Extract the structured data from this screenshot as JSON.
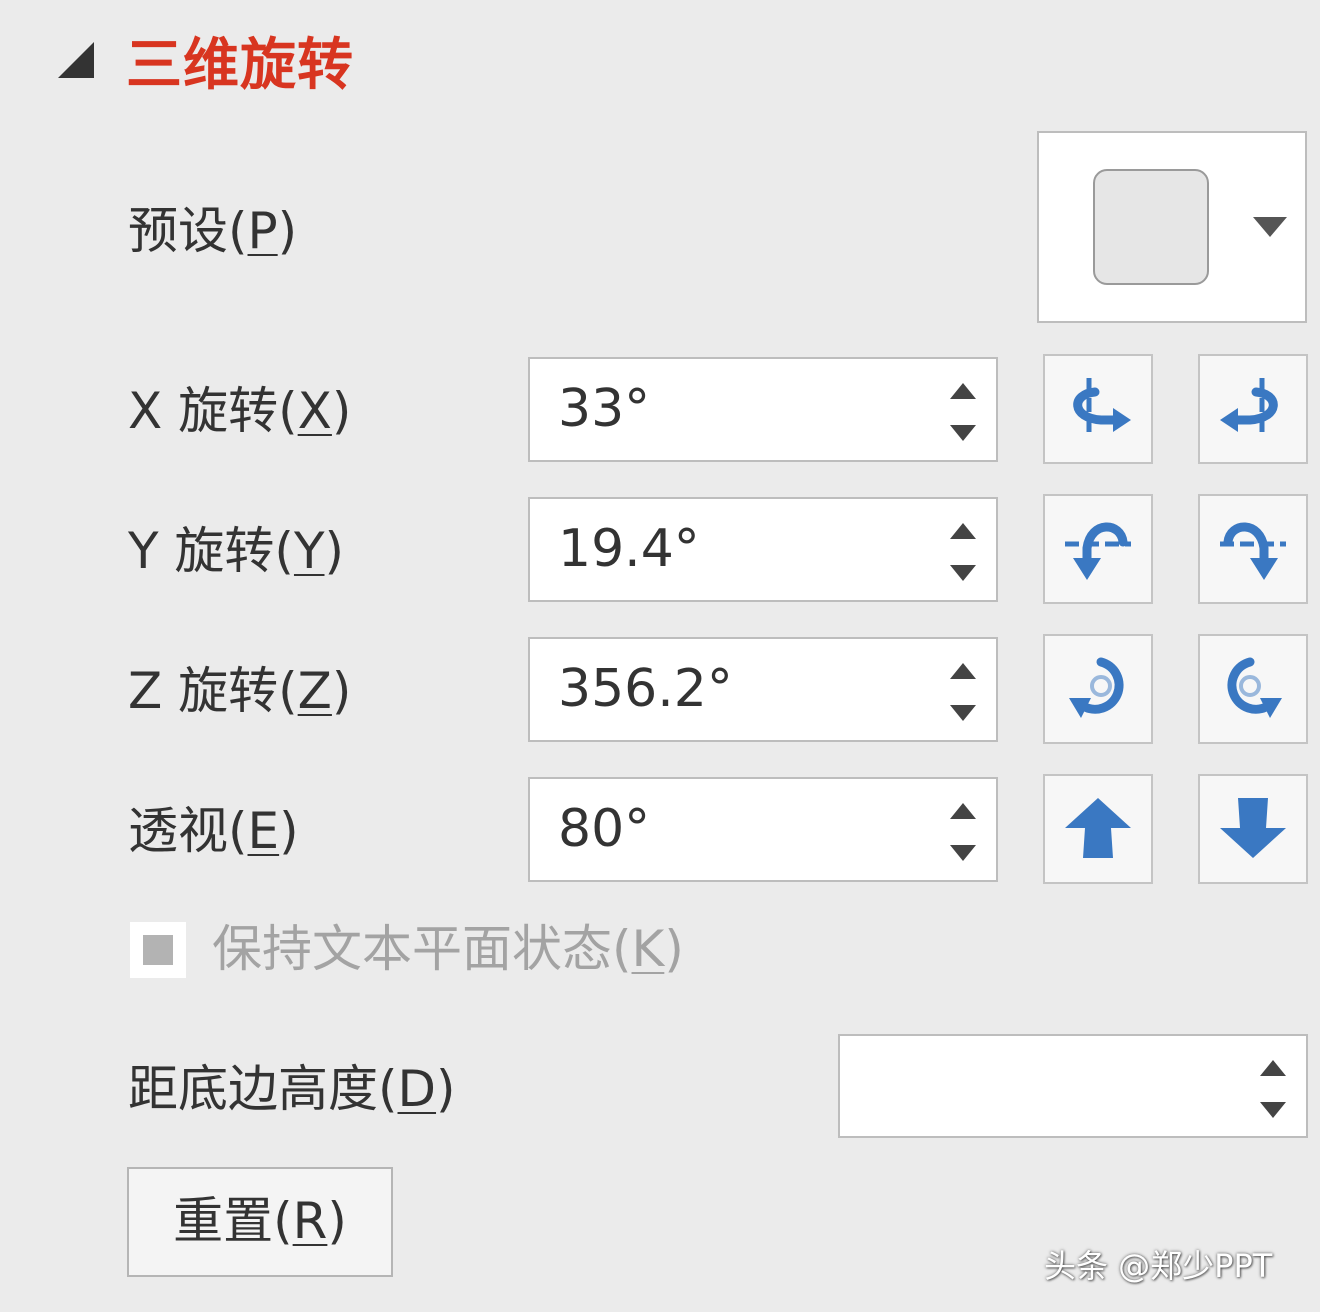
{
  "section": {
    "title": "三维旋转"
  },
  "preset": {
    "label": "预设(",
    "key": "P",
    "close": ")"
  },
  "rotations": [
    {
      "label": "X 旋转(",
      "key": "X",
      "close": ")",
      "value": "33°"
    },
    {
      "label": "Y 旋转(",
      "key": "Y",
      "close": ")",
      "value": "19.4°"
    },
    {
      "label": "Z 旋转(",
      "key": "Z",
      "close": ")",
      "value": "356.2°"
    },
    {
      "label": "透视(",
      "key": "E",
      "close": ")",
      "value": "80°"
    }
  ],
  "keep_text_flat": {
    "label": "保持文本平面状态(",
    "key": "K",
    "close": ")",
    "checked": false
  },
  "distance": {
    "label": "距底边高度(",
    "key": "D",
    "close": ")",
    "value": ""
  },
  "reset": {
    "label": "重置(",
    "key": "R",
    "close": ")"
  },
  "watermark": "头条 @郑少PPT",
  "icons": {
    "x_left": "rotate-x-left-icon",
    "x_right": "rotate-x-right-icon",
    "y_up": "rotate-y-up-icon",
    "y_down": "rotate-y-down-icon",
    "z_ccw": "rotate-z-counterclockwise-icon",
    "z_cw": "rotate-z-clockwise-icon",
    "persp_up": "perspective-increase-icon",
    "persp_down": "perspective-decrease-icon"
  },
  "colors": {
    "accent_title": "#d83520",
    "icon_blue": "#3a78c2",
    "panel_bg": "#ebebeb"
  }
}
